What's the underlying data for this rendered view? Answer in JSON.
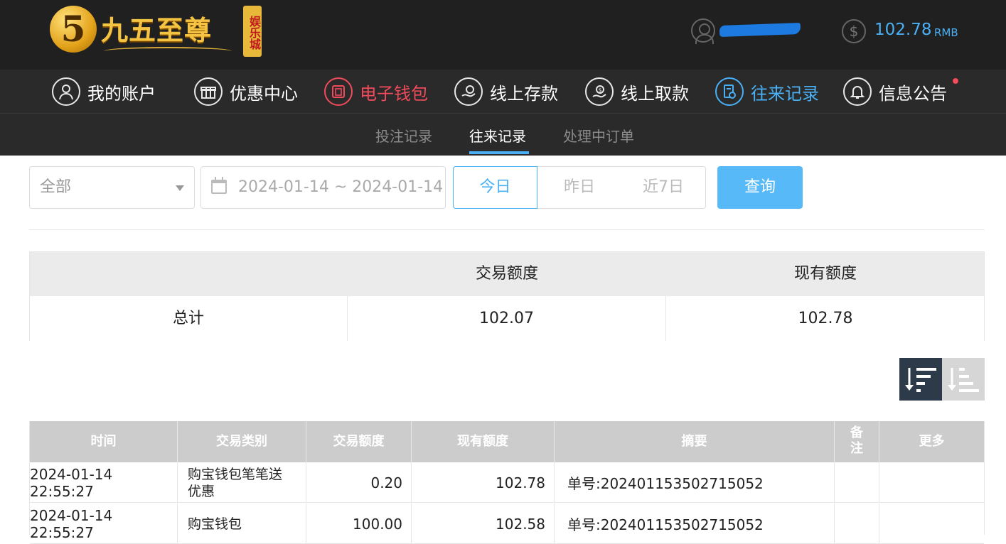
{
  "header": {
    "logo_badge": "5",
    "logo_text": "九五至尊",
    "logo_stamp": "娱乐城",
    "username": "",
    "balance_amount": "102.78",
    "balance_unit": "RMB"
  },
  "main_nav": [
    {
      "label": "我的账户",
      "icon": "user-icon",
      "state": "normal"
    },
    {
      "label": "优惠中心",
      "icon": "gift-icon",
      "state": "normal"
    },
    {
      "label": "电子钱包",
      "icon": "wallet-icon",
      "state": "highlight"
    },
    {
      "label": "线上存款",
      "icon": "deposit-icon",
      "state": "normal"
    },
    {
      "label": "线上取款",
      "icon": "withdraw-icon",
      "state": "normal"
    },
    {
      "label": "往来记录",
      "icon": "records-icon",
      "state": "active"
    },
    {
      "label": "信息公告",
      "icon": "bell-icon",
      "state": "normal"
    }
  ],
  "sub_nav": [
    {
      "label": "投注记录",
      "active": false
    },
    {
      "label": "往来记录",
      "active": true
    },
    {
      "label": "处理中订单",
      "active": false
    }
  ],
  "filters": {
    "type_select": "全部",
    "date_range": "2024-01-14 ~ 2024-01-14",
    "quick_ranges": [
      "今日",
      "昨日",
      "近7日"
    ],
    "active_range": "今日",
    "query_label": "查询"
  },
  "summary": {
    "headers": [
      "",
      "交易额度",
      "现有额度"
    ],
    "row_label": "总计",
    "trade_amount": "102.07",
    "current_amount": "102.78"
  },
  "colors": {
    "accent": "#4ab0f5",
    "highlight": "#f04a5b",
    "query_button": "#57b9f7",
    "header_bg": "#202020"
  },
  "table": {
    "columns": [
      "时间",
      "交易类别",
      "交易额度",
      "现有额度",
      "摘要",
      "备注",
      "更多"
    ],
    "rows": [
      {
        "time": "2024-01-14 22:55:27",
        "category": "购宝钱包笔笔送优惠",
        "trade": "0.20",
        "balance": "102.78",
        "summary": "单号:202401153502715052",
        "note": "",
        "more": ""
      },
      {
        "time": "2024-01-14 22:55:27",
        "category": "购宝钱包",
        "trade": "100.00",
        "balance": "102.58",
        "summary": "单号:202401153502715052",
        "note": "",
        "more": ""
      }
    ]
  }
}
